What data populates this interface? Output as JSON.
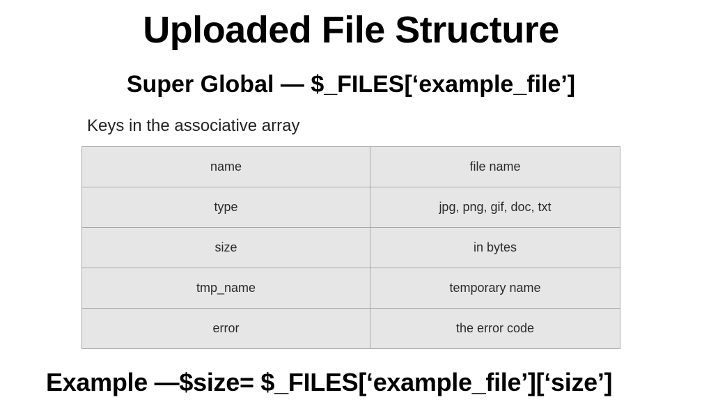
{
  "slide": {
    "title": "Uploaded File Structure",
    "subtitle": "Super Global — $_FILES[‘example_file’]",
    "caption": "Keys in the associative array",
    "table": {
      "rows": [
        {
          "key": "name",
          "description": "file name"
        },
        {
          "key": "type",
          "description": "jpg, png, gif, doc, txt"
        },
        {
          "key": "size",
          "description": "in bytes"
        },
        {
          "key": "tmp_name",
          "description": "temporary name"
        },
        {
          "key": "error",
          "description": "the error code"
        }
      ]
    },
    "example": "Example —$size= $_FILES[‘example_file’][‘size’]"
  },
  "colors": {
    "table_background": "#e6e6e6",
    "table_border": "#a9a9a9",
    "text": "#000000"
  }
}
